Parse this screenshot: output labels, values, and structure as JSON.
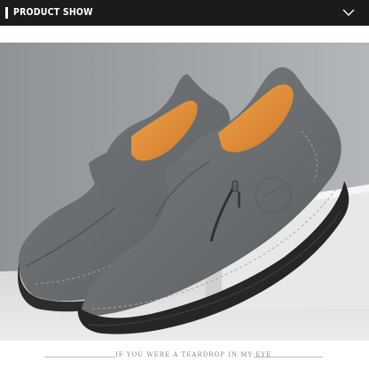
{
  "header": {
    "title": "PRODUCT SHOW",
    "menu_icon": "chevron-down-icon"
  },
  "photo": {
    "subject": "grey-leather-slip-on-loafers-with-side-zipper"
  },
  "caption": {
    "text": "IF YOU WERE A TEARDROP IN MY EYE"
  },
  "colors": {
    "header_background": "#1b1b1b",
    "leather": "#6f7274",
    "lining": "#e08a32",
    "sole": "#2a2a2a"
  }
}
